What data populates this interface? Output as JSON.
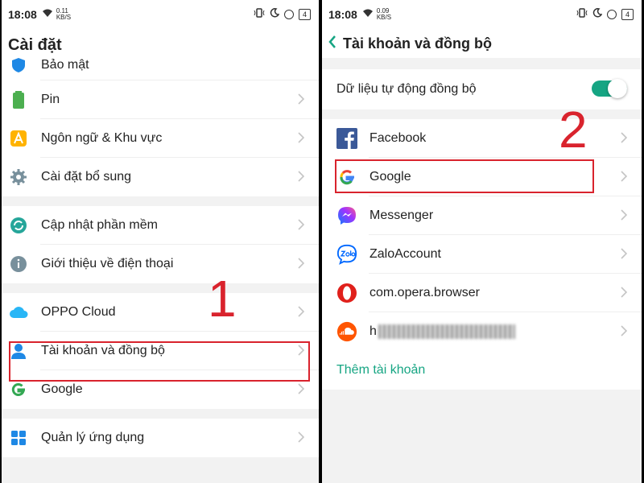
{
  "left": {
    "status": {
      "time": "18:08",
      "speed": "0.11",
      "speed_unit": "KB/S",
      "battery": "4"
    },
    "title": "Cài đặt",
    "groups": [
      [
        {
          "label": "Bảo mật",
          "icon": "shield-icon"
        },
        {
          "label": "Pin",
          "icon": "battery-icon"
        },
        {
          "label": "Ngôn ngữ & Khu vực",
          "icon": "language-icon"
        },
        {
          "label": "Cài đặt bổ sung",
          "icon": "gear-icon"
        }
      ],
      [
        {
          "label": "Cập nhật phần mềm",
          "icon": "update-icon"
        },
        {
          "label": "Giới thiệu về điện thoại",
          "icon": "info-icon"
        }
      ],
      [
        {
          "label": "OPPO Cloud",
          "icon": "cloud-icon"
        },
        {
          "label": "Tài khoản và đồng bộ",
          "icon": "account-icon"
        },
        {
          "label": "Google",
          "icon": "google-icon"
        }
      ],
      [
        {
          "label": "Quản lý ứng dụng",
          "icon": "apps-icon"
        }
      ]
    ],
    "step": "1"
  },
  "right": {
    "status": {
      "time": "18:08",
      "speed": "0.09",
      "speed_unit": "KB/S",
      "battery": "4"
    },
    "title": "Tài khoản và đồng bộ",
    "auto_sync": {
      "label": "Dữ liệu tự động đồng bộ",
      "enabled": true
    },
    "accounts": [
      {
        "label": "Facebook",
        "icon": "facebook-icon"
      },
      {
        "label": "Google",
        "icon": "google-icon"
      },
      {
        "label": "Messenger",
        "icon": "messenger-icon"
      },
      {
        "label": "ZaloAccount",
        "icon": "zalo-icon"
      },
      {
        "label": "com.opera.browser",
        "icon": "opera-icon"
      },
      {
        "label": "h",
        "icon": "soundcloud-icon"
      }
    ],
    "add_account": "Thêm tài khoản",
    "step": "2"
  },
  "colors": {
    "accent": "#16a583",
    "highlight": "#d9232d"
  }
}
